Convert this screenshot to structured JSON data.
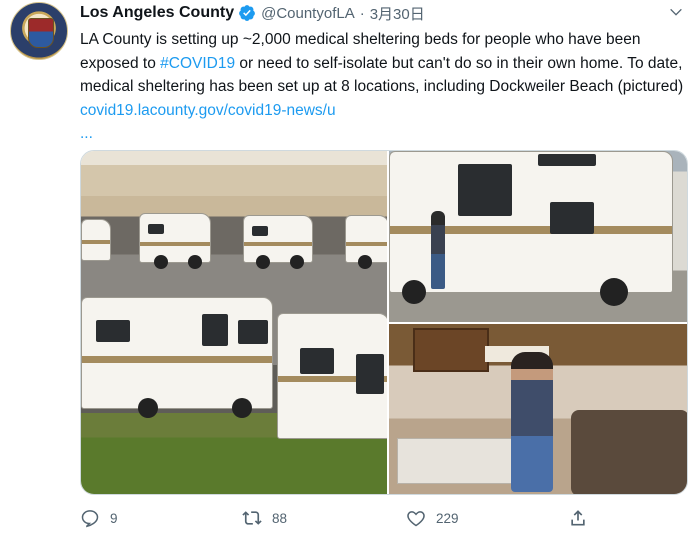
{
  "tweet": {
    "author_name": "Los Angeles County",
    "handle": "@CountyofLA",
    "separator": "·",
    "date": "3月30日",
    "text_prefix": "LA County is setting up ~2,000 medical sheltering beds for people who have been exposed to ",
    "hashtag": "#COVID19",
    "text_middle": " or need to self-isolate but can't do so in their own home. To date, medical sheltering has been set up at 8 locations, including Dockweiler Beach (pictured) ",
    "link": "covid19.lacounty.gov/covid19-news/u",
    "link_ellipsis": "..."
  },
  "actions": {
    "reply_count": "9",
    "retweet_count": "88",
    "like_count": "229"
  },
  "colors": {
    "link": "#1d9bf0",
    "verified": "#1d9bf0",
    "muted": "#536471"
  },
  "icons": [
    "verified-badge-icon",
    "chevron-down-icon",
    "reply-icon",
    "retweet-icon",
    "like-icon",
    "share-icon"
  ]
}
